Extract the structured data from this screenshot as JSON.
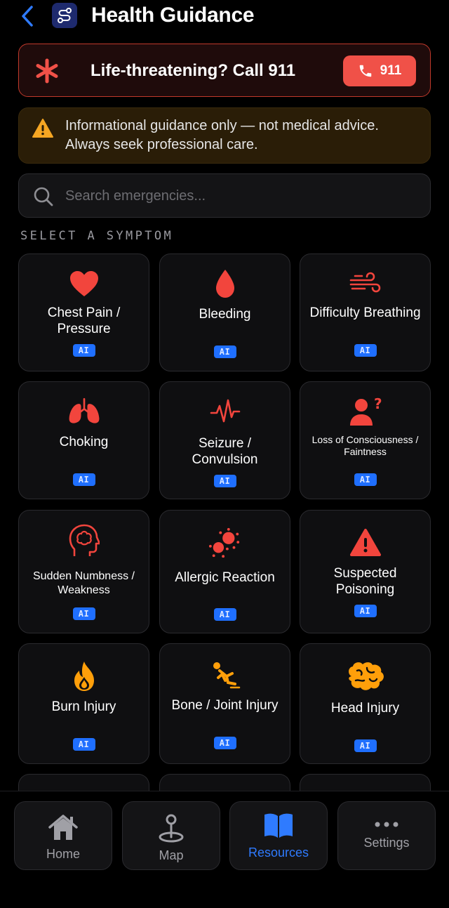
{
  "header": {
    "title": "Health Guidance"
  },
  "emergency": {
    "text": "Life-threatening? Call 911",
    "call_label": "911"
  },
  "disclaimer": {
    "line1": "Informational guidance only — not medical advice.",
    "line2": "Always seek professional care."
  },
  "search": {
    "placeholder": "Search emergencies..."
  },
  "section_label": "SELECT A SYMPTOM",
  "symptoms": [
    {
      "label": "Chest Pain / Pressure",
      "badge": "AI",
      "icon": "heart-icon"
    },
    {
      "label": "Bleeding",
      "badge": "AI",
      "icon": "drop-icon"
    },
    {
      "label": "Difficulty Breathing",
      "badge": "AI",
      "icon": "wind-icon"
    },
    {
      "label": "Choking",
      "badge": "AI",
      "icon": "lungs-icon"
    },
    {
      "label": "Seizure / Convulsion",
      "badge": "AI",
      "icon": "waveform-icon"
    },
    {
      "label": "Loss of Consciousness / Faintness",
      "badge": "AI",
      "icon": "person-question-icon"
    },
    {
      "label": "Sudden Numbness / Weakness",
      "badge": "AI",
      "icon": "brain-head-icon"
    },
    {
      "label": "Allergic Reaction",
      "badge": "AI",
      "icon": "allergen-icon"
    },
    {
      "label": "Suspected Poisoning",
      "badge": "AI",
      "icon": "warning-icon"
    },
    {
      "label": "Burn Injury",
      "badge": "AI",
      "icon": "flame-icon"
    },
    {
      "label": "Bone / Joint Injury",
      "badge": "AI",
      "icon": "falling-person-icon"
    },
    {
      "label": "Head Injury",
      "badge": "AI",
      "icon": "brain-icon"
    }
  ],
  "tabs": [
    {
      "label": "Home",
      "icon": "house-icon"
    },
    {
      "label": "Map",
      "icon": "map-pin-icon"
    },
    {
      "label": "Resources",
      "icon": "book-icon"
    },
    {
      "label": "Settings",
      "icon": "ellipsis-icon"
    }
  ],
  "colors": {
    "accent": "#1f6fff",
    "emergency": "#f05148",
    "warning": "#f5a623",
    "burn": "#ff9f0a"
  }
}
